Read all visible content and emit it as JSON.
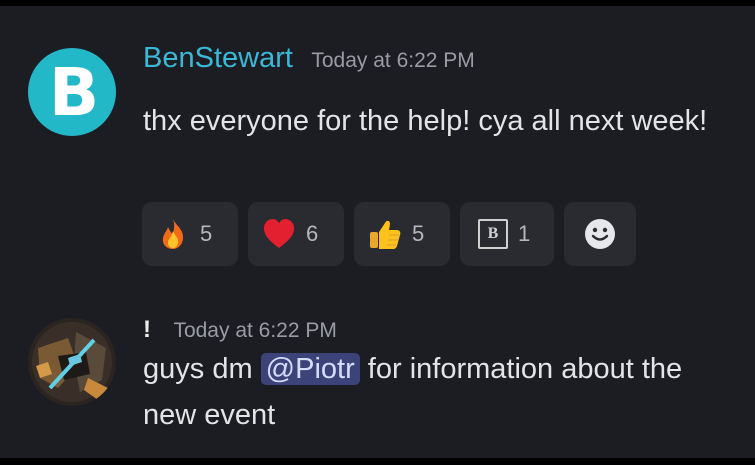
{
  "messages": [
    {
      "avatar_letter": "B",
      "username": "BenStewart",
      "timestamp": "Today at 6:22 PM",
      "text": "thx everyone for the help! cya all next week!",
      "reactions": [
        {
          "emoji": "fire-emoji",
          "count": "5"
        },
        {
          "emoji": "heart-emoji",
          "count": "6"
        },
        {
          "emoji": "thumbs-up-emoji",
          "count": "5"
        },
        {
          "emoji": "custom-b-emoji",
          "label": "B",
          "count": "1"
        }
      ],
      "add_reaction_icon": "smiley-add-reaction-icon"
    },
    {
      "username": "!",
      "timestamp": "Today at 6:22 PM",
      "text_before": "guys dm ",
      "mention": "@Piotr",
      "text_after": " for information about the new event"
    }
  ],
  "colors": {
    "background": "#1c1d22",
    "username": "#3ab8d8",
    "mention_bg": "#3c4378",
    "reaction_bg": "#2a2b31"
  }
}
